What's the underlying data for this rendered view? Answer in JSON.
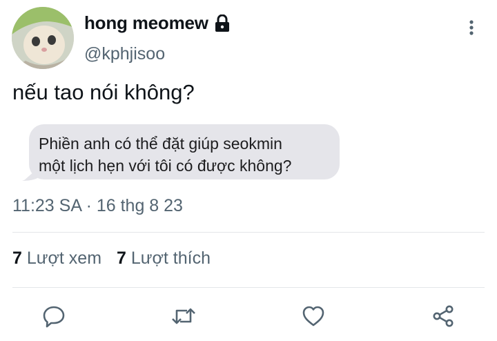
{
  "user": {
    "display_name": "hong meomew",
    "handle": "@kphjisoo",
    "avatar_icon": "cat-avatar",
    "protected_icon": "lock-icon"
  },
  "tweet": {
    "text": "nếu tao nói không?",
    "image_bubble_text_line1": "Phiền anh có thể đặt giúp seokmin",
    "image_bubble_text_line2": "một lịch hẹn với tôi có được không?",
    "timestamp": "11:23 SA · 16 thg 8 23"
  },
  "stats": {
    "views_count": "7",
    "views_label": "Lượt xem",
    "likes_count": "7",
    "likes_label": "Lượt thích"
  },
  "actions": {
    "reply_icon": "reply-icon",
    "retweet_icon": "retweet-icon",
    "like_icon": "heart-icon",
    "share_icon": "share-icon"
  },
  "colors": {
    "text_primary": "#0f1419",
    "text_secondary": "#536471",
    "bubble_bg": "#e5e5ea",
    "divider": "#e3e6e9"
  }
}
